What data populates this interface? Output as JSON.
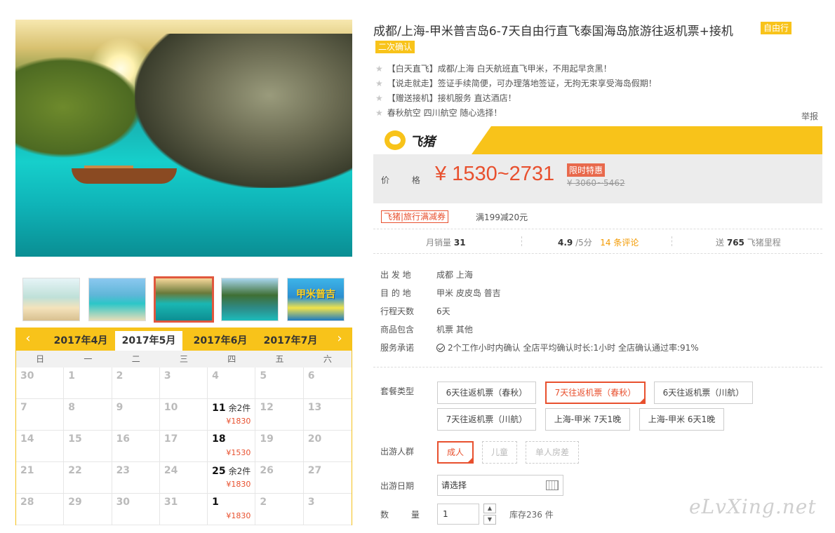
{
  "product": {
    "title": "成都/上海-甲米普吉岛6-7天自由行直飞泰国海岛旅游往返机票+接机",
    "tag_ziyou": "自由行",
    "tag_confirm": "二次确认",
    "features": [
      "【白天直飞】成都/上海 白天航班直飞甲米，不用起早贪黑！",
      "【说走就走】签证手续简便，可办理落地签证，无拘无束享受海岛假期！",
      "【赠送接机】接机服务 直达酒店！",
      "春秋航空 四川航空 随心选择！"
    ],
    "report": "举报"
  },
  "brand": {
    "name": "飞猪"
  },
  "price": {
    "label": "价 格",
    "value": "¥ 1530~2731",
    "limit_tag": "限时特惠",
    "old": "¥ 3060~5462"
  },
  "coupon": {
    "tag": "飞猪|旅行满减券",
    "text": "满199减20元"
  },
  "stats": {
    "sales_label": "月销量",
    "sales": "31",
    "score": "4.9",
    "score_suffix": "/5分",
    "reviews": "14 条评论",
    "miles_prefix": "送",
    "miles": "765",
    "miles_suffix": "飞猪里程"
  },
  "info": [
    {
      "label": "出 发 地",
      "value": "成都   上海"
    },
    {
      "label": "目 的 地",
      "value": "甲米   皮皮岛   普吉"
    },
    {
      "label": "行程天数",
      "value": "6天"
    },
    {
      "label": "商品包含",
      "value": "机票   其他"
    },
    {
      "label": "服务承诺",
      "value": "2个工作小时内确认    全店平均确认时长:1小时    全店确认通过率:91%"
    }
  ],
  "options": {
    "package_label": "套餐类型",
    "packages": [
      "6天往返机票（春秋）",
      "7天往返机票（春秋）",
      "6天往返机票（川航）",
      "7天往返机票（川航）",
      "上海-甲米 7天1晚",
      "上海-甲米 6天1晚"
    ],
    "group_label": "出游人群",
    "groups": [
      "成人",
      "儿童",
      "单人房差"
    ],
    "date_label": "出游日期",
    "date_placeholder": "请选择",
    "qty_label": "数 量",
    "qty": "1",
    "stock": "库存236 件"
  },
  "calendar": {
    "months": [
      "2017年4月",
      "2017年5月",
      "2017年6月",
      "2017年7月"
    ],
    "active_month": "2017年5月",
    "weekdays": [
      "日",
      "一",
      "二",
      "三",
      "四",
      "五",
      "六"
    ],
    "weeks": [
      [
        {
          "d": "30"
        },
        {
          "d": "1"
        },
        {
          "d": "2"
        },
        {
          "d": "3"
        },
        {
          "d": "4"
        },
        {
          "d": "5"
        },
        {
          "d": "6"
        }
      ],
      [
        {
          "d": "7"
        },
        {
          "d": "8"
        },
        {
          "d": "9"
        },
        {
          "d": "10"
        },
        {
          "d": "11",
          "rem": "余2件",
          "price": "¥1830"
        },
        {
          "d": "12"
        },
        {
          "d": "13"
        }
      ],
      [
        {
          "d": "14"
        },
        {
          "d": "15"
        },
        {
          "d": "16"
        },
        {
          "d": "17"
        },
        {
          "d": "18",
          "price": "¥1530"
        },
        {
          "d": "19"
        },
        {
          "d": "20"
        }
      ],
      [
        {
          "d": "21"
        },
        {
          "d": "22"
        },
        {
          "d": "23"
        },
        {
          "d": "24"
        },
        {
          "d": "25",
          "rem": "余2件",
          "price": "¥1830"
        },
        {
          "d": "26"
        },
        {
          "d": "27"
        }
      ],
      [
        {
          "d": "28"
        },
        {
          "d": "29"
        },
        {
          "d": "30"
        },
        {
          "d": "31"
        },
        {
          "d": "1",
          "price": "¥1830"
        },
        {
          "d": "2"
        },
        {
          "d": "3"
        }
      ]
    ]
  },
  "thumb5_text": "甲米普吉",
  "watermark": "eLvXing.net"
}
